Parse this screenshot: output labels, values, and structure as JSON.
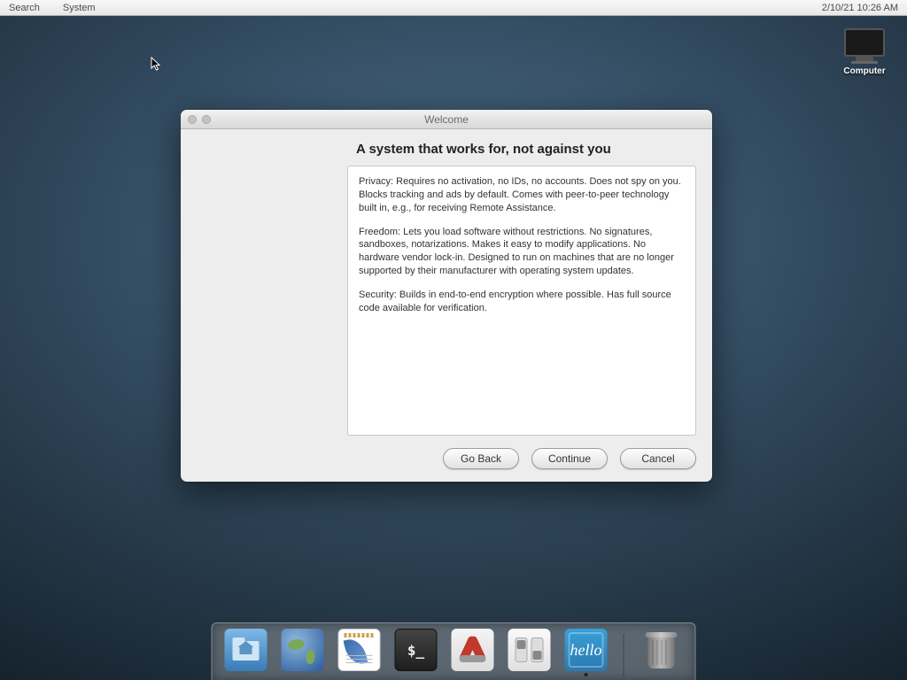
{
  "menubar": {
    "search": "Search",
    "system": "System",
    "datetime": "2/10/21 10:26 AM"
  },
  "desktop": {
    "computer_label": "Computer"
  },
  "window": {
    "title": "Welcome",
    "heading": "A system that works for, not against you",
    "paragraphs": [
      "Privacy: Requires no activation, no IDs, no accounts. Does not spy on you. Blocks tracking and ads by default. Comes with peer-to-peer technology built in, e.g., for receiving Remote Assistance.",
      "Freedom: Lets you load software without restrictions. No signatures, sandboxes, notarizations. Makes it easy to modify applications. No hardware vendor lock-in. Designed to run on machines that are no longer supported by their manufacturer with operating system updates.",
      "Security: Builds in end-to-end encryption where possible. Has full source code available for verification."
    ],
    "buttons": {
      "back": "Go Back",
      "continue": "Continue",
      "cancel": "Cancel"
    }
  },
  "dock": {
    "items": [
      {
        "name": "files"
      },
      {
        "name": "web"
      },
      {
        "name": "editor"
      },
      {
        "name": "terminal"
      },
      {
        "name": "utilities"
      },
      {
        "name": "preferences"
      },
      {
        "name": "hello",
        "running": true
      },
      {
        "name": "trash"
      }
    ],
    "hello_text": "hello",
    "term_prompt": "$_"
  }
}
